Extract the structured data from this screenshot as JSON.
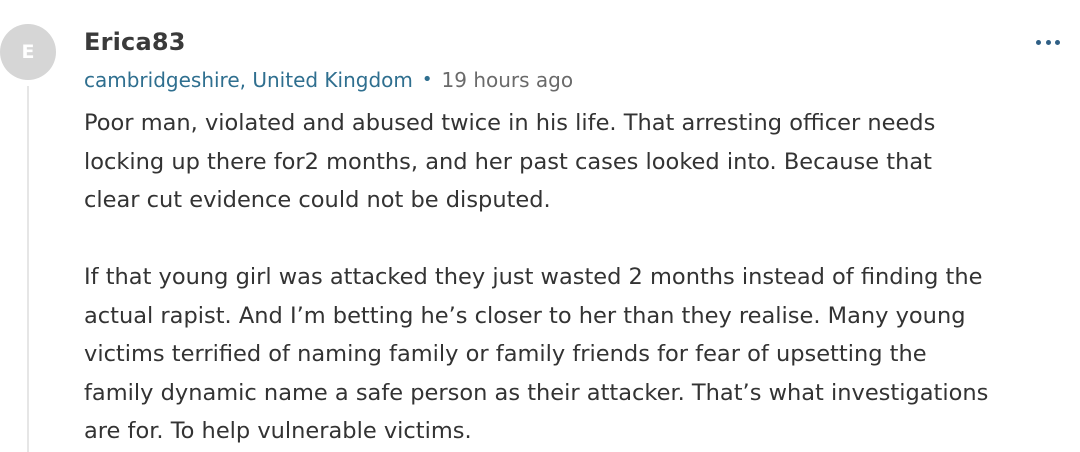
{
  "comment": {
    "avatar_initial": "E",
    "username": "Erica83",
    "location": "cambridgeshire, United Kingdom",
    "separator": "•",
    "time": "19 hours ago",
    "more_icon": "more-horizontal-icon",
    "paragraph1": [
      "Poor man, violated and abused twice in his life. That arresting officer needs",
      "locking up there for2 months, and her past cases looked into. Because that",
      "clear cut evidence could not be disputed."
    ],
    "paragraph2": [
      "If that young girl was attacked they just wasted 2 months instead of finding the",
      "actual rapist. And I’m betting he’s closer to her than they realise. Many young",
      "victims terrified of naming family or family friends for fear of upsetting the",
      "family dynamic name a safe person as their attacker. That’s what investigations",
      "are for. To help vulnerable victims."
    ]
  },
  "colors": {
    "avatar_bg": "#d6d6d6",
    "link": "#2f6f8f",
    "text": "#333333",
    "username": "#3a3a3a"
  }
}
